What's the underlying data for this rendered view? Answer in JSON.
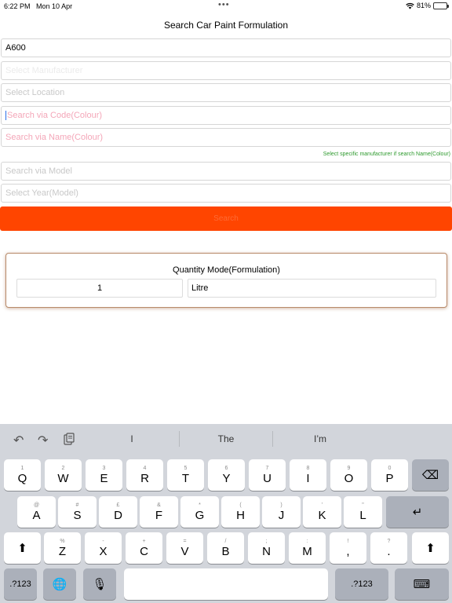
{
  "status_bar": {
    "time": "6:22 PM",
    "date": "Mon 10 Apr",
    "dots": "•••",
    "battery": "81%",
    "battery_level": 0.81
  },
  "page": {
    "title": "Search Car Paint Formulation"
  },
  "form": {
    "manufacturer_value": "A600",
    "manufacturer2_placeholder": "Select Manufacturer",
    "location_placeholder": "Select Location",
    "code_placeholder": "Search via Code(Colour)",
    "name_placeholder": "Search via Name(Colour)",
    "hint": "Select specific manufacturer if search Name(Colour)",
    "model_placeholder": "Search via Model",
    "year_placeholder": "Select Year(Model)",
    "search_label": "Search"
  },
  "quantity": {
    "title": "Quantity Mode(Formulation)",
    "amount": "1",
    "unit": "Litre"
  },
  "keyboard": {
    "suggestions": [
      "I",
      "The",
      "I’m"
    ],
    "icons": [
      "undo-icon",
      "redo-icon",
      "paste-icon"
    ],
    "row1": [
      {
        "main": "Q",
        "sub": "1"
      },
      {
        "main": "W",
        "sub": "2"
      },
      {
        "main": "E",
        "sub": "3"
      },
      {
        "main": "R",
        "sub": "4"
      },
      {
        "main": "T",
        "sub": "5"
      },
      {
        "main": "Y",
        "sub": "6"
      },
      {
        "main": "U",
        "sub": "7"
      },
      {
        "main": "I",
        "sub": "8"
      },
      {
        "main": "O",
        "sub": "9"
      },
      {
        "main": "P",
        "sub": "0"
      }
    ],
    "row2": [
      {
        "main": "A",
        "sub": "@"
      },
      {
        "main": "S",
        "sub": "#"
      },
      {
        "main": "D",
        "sub": "£"
      },
      {
        "main": "F",
        "sub": "&"
      },
      {
        "main": "G",
        "sub": "*"
      },
      {
        "main": "H",
        "sub": "("
      },
      {
        "main": "J",
        "sub": ")"
      },
      {
        "main": "K",
        "sub": "’"
      },
      {
        "main": "L",
        "sub": "\""
      }
    ],
    "row3": [
      {
        "main": "Z",
        "sub": "%"
      },
      {
        "main": "X",
        "sub": "-"
      },
      {
        "main": "C",
        "sub": "+"
      },
      {
        "main": "V",
        "sub": "="
      },
      {
        "main": "B",
        "sub": "/"
      },
      {
        "main": "N",
        "sub": ";"
      },
      {
        "main": "M",
        "sub": ":"
      },
      {
        "main": ",",
        "sub": "!"
      },
      {
        "main": ".",
        "sub": "?"
      }
    ],
    "numbers_label": ".?123",
    "shift_glyph": "⬆",
    "delete_glyph": "⌫",
    "return_glyph": "↵",
    "globe_glyph": "🌐",
    "mic_glyph": "🎙",
    "hide_glyph": "⌨"
  }
}
